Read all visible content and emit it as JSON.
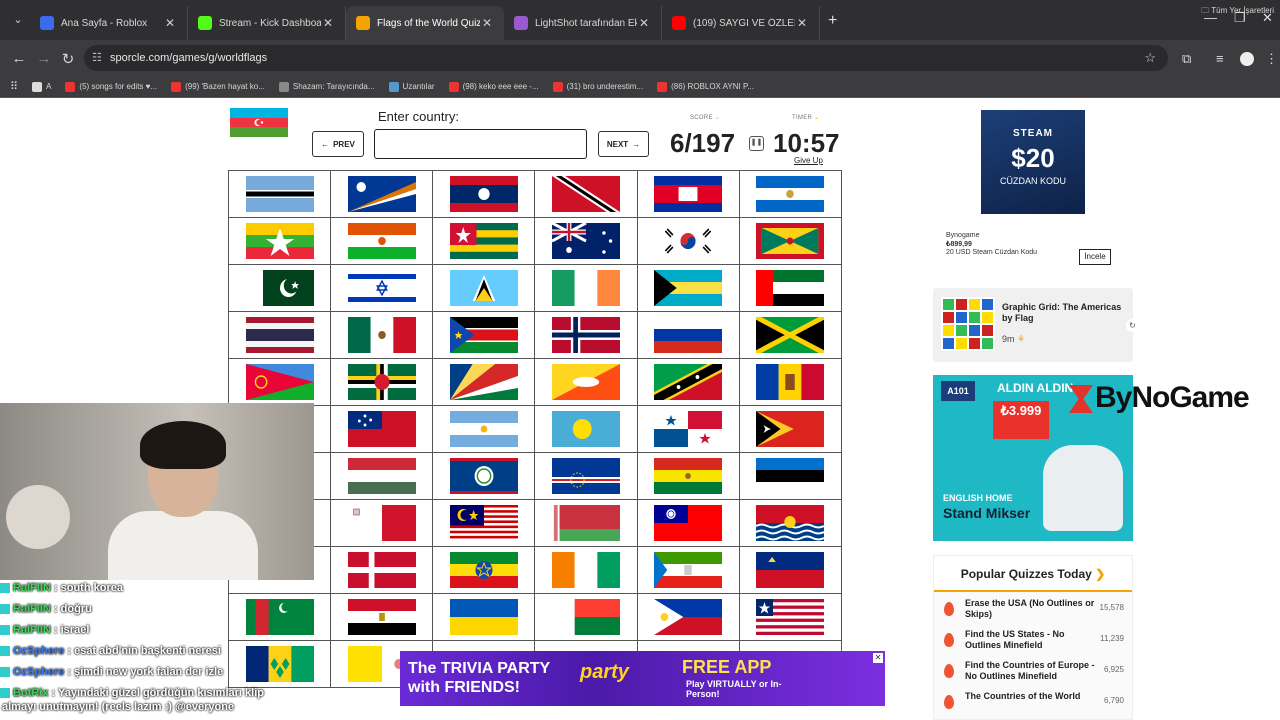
{
  "browser": {
    "tabs": [
      {
        "title": "Ana Sayfa - Roblox",
        "color": "#3b6cf0",
        "active": false
      },
      {
        "title": "Stream - Kick Dashboard",
        "color": "#53fc18",
        "active": false
      },
      {
        "title": "Flags of the World Quiz",
        "color": "#f4a300",
        "active": true
      },
      {
        "title": "LightShot tarafından Ekran Gör",
        "color": "#9b59d0",
        "active": false
      },
      {
        "title": "(109) SAYGI VE ÖZLEMLE.. | Ma",
        "color": "#ff0000",
        "active": false
      }
    ],
    "url": "sporcle.com/games/g/worldflags",
    "bookmarks": [
      "A",
      "(5) songs for edits ♥...",
      "(99) 'Bazen hayat ko...",
      "Shazam: Tarayıcında...",
      "Uzantılar",
      "(98) keko eee eee -...",
      "(31) bro underestim...",
      "(86) ROBLOX AYNI P..."
    ],
    "bookmarks_right": "Tüm Yer İşaretleri"
  },
  "quiz": {
    "enter_label": "Enter country:",
    "input_value": "",
    "prev_label": "PREV",
    "next_label": "NEXT",
    "score_label": "SCORE",
    "score": "6/197",
    "timer_label": "TIMER",
    "timer": "10:57",
    "give_up": "Give Up",
    "current_flag": "azerbaijan",
    "flag_grid": [
      [
        "botswana",
        "marshall-islands",
        "laos",
        "trinidad-and-tobago",
        "cambodia",
        "nicaragua"
      ],
      [
        "myanmar",
        "niger",
        "togo",
        "australia",
        "south-korea",
        "grenada"
      ],
      [
        "pakistan",
        "israel",
        "saint-lucia",
        "ireland",
        "bahamas",
        "uae"
      ],
      [
        "thailand",
        "mexico",
        "south-sudan",
        "norway",
        "russia",
        "jamaica"
      ],
      [
        "eritrea",
        "dominica",
        "seychelles",
        "bhutan",
        "saint-kitts-and-nevis",
        "moldova"
      ],
      [
        "hidden",
        "samoa",
        "argentina",
        "palau",
        "panama",
        "east-timor"
      ],
      [
        "hidden",
        "hungary",
        "belize",
        "cape-verde",
        "bolivia",
        "estonia"
      ],
      [
        "hidden",
        "malta",
        "malaysia",
        "belarus",
        "taiwan",
        "kiribati"
      ],
      [
        "hidden",
        "denmark",
        "ethiopia",
        "ivory-coast",
        "equatorial-guinea",
        "liechtenstein"
      ],
      [
        "turkmenistan",
        "egypt",
        "ukraine",
        "madagascar",
        "philippines",
        "liberia"
      ],
      [
        "saint-vincent",
        "vatican",
        "hidden",
        "hidden",
        "hidden",
        "hidden"
      ]
    ]
  },
  "ads": {
    "steam": {
      "brand": "STEAM",
      "amount": "$20",
      "sub": "CÜZDAN KODU"
    },
    "steam_seller": "Bynogame",
    "steam_price": "₺899,99",
    "steam_desc": "20 USD Steam Cüzdan Kodu",
    "steam_cta": "İncele",
    "a101_logo": "A101",
    "a101_heading": "ALDIN ALDIN",
    "a101_price": "3.999",
    "a101_brand": "ENGLISH HOME",
    "a101_product": "Stand Mikser",
    "bynogame": "ByNoGame",
    "trivia_left": "The TRIVIA PARTY with FRIENDS!",
    "trivia_brand": "party",
    "trivia_app": "FREE APP",
    "trivia_sub": "Play VIRTUALLY or In-Person!"
  },
  "recommended": {
    "title": "Graphic Grid: The Americas by Flag",
    "time": "9m"
  },
  "popular": {
    "heading": "Popular Quizzes Today",
    "items": [
      {
        "title": "Erase the USA (No Outlines or Skips)",
        "count": "15,578"
      },
      {
        "title": "Find the US States - No Outlines Minefield",
        "count": "11,239"
      },
      {
        "title": "Find the Countries of Europe - No Outlines Minefield",
        "count": "6,925"
      },
      {
        "title": "The Countries of the World",
        "count": "6,790"
      }
    ]
  },
  "chat": [
    {
      "nick": "RalFIIN",
      "msg": ": south korea",
      "color": "#3ed65a"
    },
    {
      "nick": "RalFIIN",
      "msg": ": doğru",
      "color": "#3ed65a"
    },
    {
      "nick": "RalFIIN",
      "msg": ": israel",
      "color": "#3ed65a"
    },
    {
      "nick": "OzSphere",
      "msg": ": esat abd'nin başkenti neresi",
      "color": "#3c7bf0"
    },
    {
      "nick": "OzSphere",
      "msg": ": şimdi new york falan der izle",
      "color": "#3c7bf0"
    },
    {
      "nick": "BotRix",
      "msg": ": Yayındaki güzel gördüğün kısımları klip",
      "color": "#3ed65a"
    }
  ],
  "chat_last": "almayı unutmayın! (reels lazım :) @everyone"
}
